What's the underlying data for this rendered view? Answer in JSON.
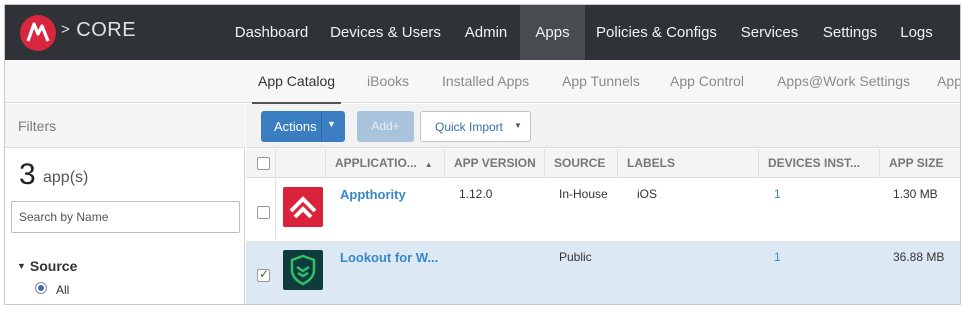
{
  "brand": {
    "name": "CORE",
    "chevron": ">"
  },
  "nav": {
    "items": [
      {
        "label": "Dashboard"
      },
      {
        "label": "Devices & Users"
      },
      {
        "label": "Admin"
      },
      {
        "label": "Apps",
        "active": true
      },
      {
        "label": "Policies & Configs"
      },
      {
        "label": "Services"
      },
      {
        "label": "Settings"
      },
      {
        "label": "Logs"
      }
    ]
  },
  "subnav": {
    "items": [
      {
        "label": "App Catalog",
        "active": true
      },
      {
        "label": "iBooks"
      },
      {
        "label": "Installed Apps"
      },
      {
        "label": "App Tunnels"
      },
      {
        "label": "App Control"
      },
      {
        "label": "Apps@Work Settings"
      },
      {
        "label": "App"
      }
    ]
  },
  "filters": {
    "title": "Filters",
    "count": "3",
    "count_unit": "app(s)",
    "search_placeholder": "Search by Name",
    "source_title": "Source",
    "source_option": "All"
  },
  "toolbar": {
    "actions_label": "Actions",
    "add_label": "Add+",
    "quick_import_label": "Quick Import"
  },
  "table": {
    "columns": [
      "APPLICATIO...",
      "APP VERSION",
      "SOURCE",
      "LABELS",
      "DEVICES INST...",
      "APP SIZE"
    ],
    "rows": [
      {
        "name": "Appthority",
        "version": "1.12.0",
        "source": "In-House",
        "labels": "iOS",
        "devices": "1",
        "size": "1.30 MB",
        "checked": false,
        "icon": "appthority-icon"
      },
      {
        "name": "Lookout for W...",
        "version": "",
        "source": "Public",
        "labels": "",
        "devices": "1",
        "size": "36.88 MB",
        "checked": true,
        "icon": "lookout-icon"
      }
    ]
  },
  "colors": {
    "topbar": "#2f3338",
    "accent": "#3a7dc0",
    "link": "#3a87c8",
    "selected_row": "#dce9f5",
    "appthority_red": "#d8233a",
    "lookout_green": "#2fbf6a"
  }
}
